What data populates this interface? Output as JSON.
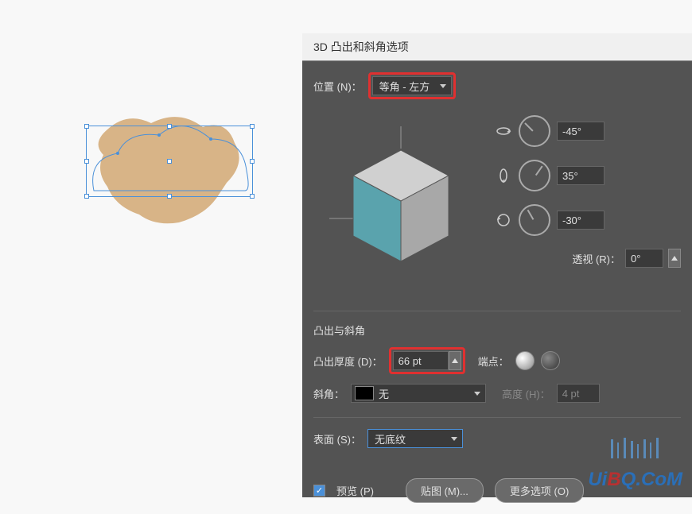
{
  "dialog": {
    "title": "3D 凸出和斜角选项",
    "position": {
      "label": "位置 (N)：",
      "value": "等角 - 左方"
    },
    "rotation": {
      "x": {
        "value": "-45°"
      },
      "y": {
        "value": "35°"
      },
      "z": {
        "value": "-30°"
      }
    },
    "perspective": {
      "label": "透视 (R)：",
      "value": "0°"
    },
    "extrude": {
      "section_title": "凸出与斜角",
      "depth_label": "凸出厚度 (D)：",
      "depth_value": "66 pt",
      "cap_label": "端点："
    },
    "bevel": {
      "label": "斜角：",
      "value": "无",
      "height_label": "高度 (H)：",
      "height_value": "4 pt"
    },
    "surface": {
      "label": "表面 (S)：",
      "value": "无底纹"
    },
    "footer": {
      "preview_label": "预览 (P)",
      "map_label": "贴图 (M)...",
      "more_label": "更多选项 (O)"
    }
  },
  "watermark": {
    "prefix": "Ui",
    "mid": "B",
    "rest": "Q.CoM"
  },
  "chart_data": null
}
